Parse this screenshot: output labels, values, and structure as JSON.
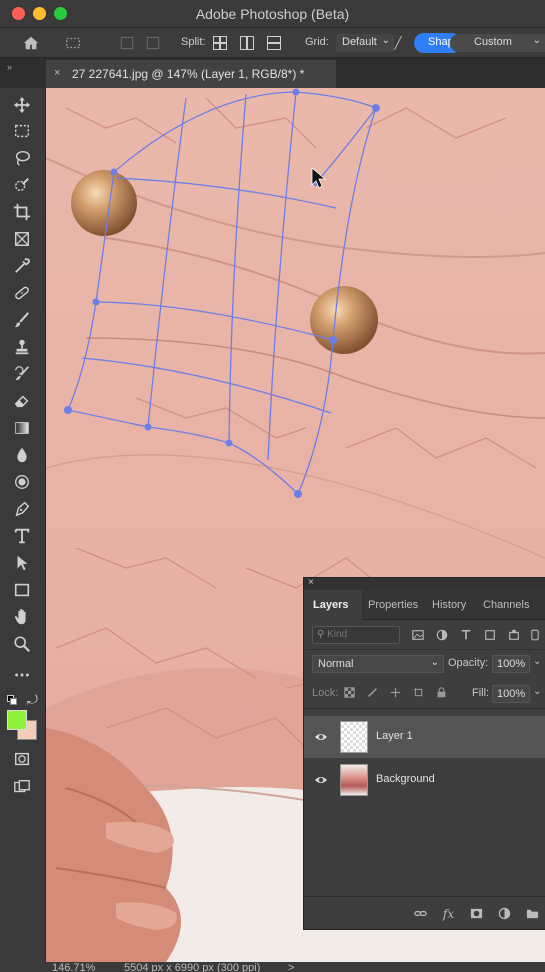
{
  "window": {
    "title": "Adobe Photoshop (Beta)"
  },
  "traffic_colors": {
    "close": "#fe5f57",
    "minimize": "#febc2e",
    "zoom": "#28c840"
  },
  "options_bar": {
    "split_label": "Split:",
    "grid_label": "Grid:",
    "grid_value": "Default",
    "shape_button_label": "Shape",
    "custom_value": "Custom",
    "accent_color": "#2f7ef4"
  },
  "document_tab": {
    "close_glyph": "×",
    "title": "27 227641.jpg @ 147% (Layer 1, RGB/8*) *"
  },
  "toolbar": {
    "tools": [
      "move-icon",
      "marquee-icon",
      "lasso-icon",
      "quick-select-icon",
      "crop-icon",
      "frame-icon",
      "eyedropper-icon",
      "healing-icon",
      "brush-icon",
      "stamp-icon",
      "history-brush-icon",
      "eraser-icon",
      "gradient-icon",
      "blur-icon",
      "dodge-icon",
      "pen-icon",
      "type-icon",
      "path-select-icon",
      "rectangle-icon",
      "hand-icon",
      "zoom-icon",
      "more-icon"
    ],
    "foreground_color": "#8ff23d",
    "background_color": "#f3cdb8"
  },
  "status_bar": {
    "zoom": "146.71%",
    "doc_size": "5504 px x 6990 px (300 ppi)",
    "arrow": ">"
  },
  "layers_panel": {
    "close_glyph": "×",
    "tabs": [
      "Layers",
      "Properties",
      "History",
      "Channels"
    ],
    "active_tab": "Layers",
    "filter_placeholder": "Kind",
    "blend_mode": "Normal",
    "opacity_label": "Opacity:",
    "opacity_value": "100%",
    "lock_label": "Lock:",
    "fill_label": "Fill:",
    "fill_value": "100%",
    "layers": [
      {
        "name": "Layer 1",
        "selected": true
      },
      {
        "name": "Background",
        "selected": false
      }
    ]
  }
}
